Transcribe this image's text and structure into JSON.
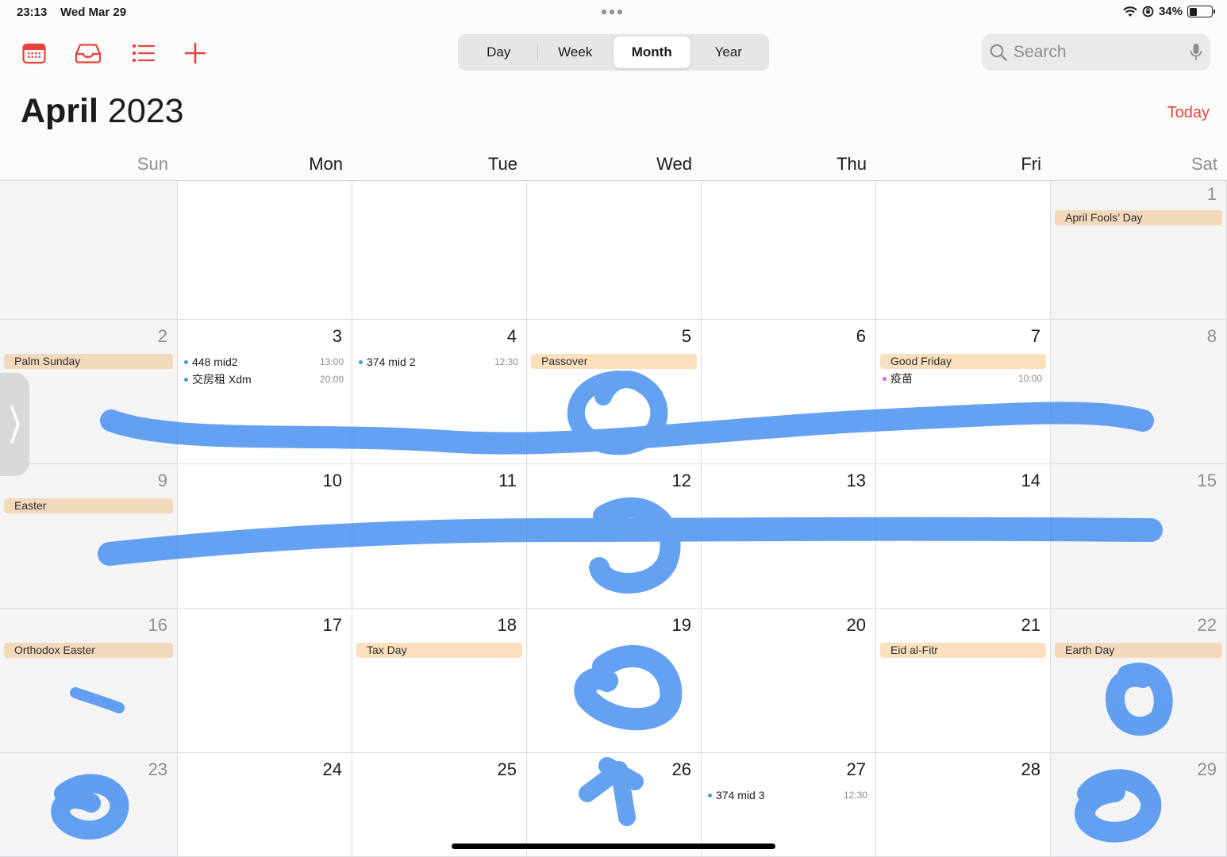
{
  "status_bar": {
    "time": "23:13",
    "date": "Wed Mar 29",
    "battery": "34%",
    "battery_level": 0.34
  },
  "toolbar": {
    "icons": [
      "calendar-icon",
      "inbox-icon",
      "list-icon",
      "add-icon"
    ],
    "views": [
      {
        "label": "Day",
        "active": false
      },
      {
        "label": "Week",
        "active": false
      },
      {
        "label": "Month",
        "active": true
      },
      {
        "label": "Year",
        "active": false
      }
    ],
    "search_placeholder": "Search"
  },
  "header": {
    "month": "April",
    "year": "2023",
    "today_label": "Today"
  },
  "weekdays": [
    "Sun",
    "Mon",
    "Tue",
    "Wed",
    "Thu",
    "Fri",
    "Sat"
  ],
  "weeks": [
    [
      {
        "day": ""
      },
      {
        "day": ""
      },
      {
        "day": ""
      },
      {
        "day": ""
      },
      {
        "day": ""
      },
      {
        "day": ""
      },
      {
        "day": "1",
        "allday": "April Fools’ Day"
      }
    ],
    [
      {
        "day": "2",
        "allday": "Palm Sunday"
      },
      {
        "day": "3",
        "events": [
          {
            "title": "448 mid2",
            "time": "13:00",
            "color": "#3b9eda"
          },
          {
            "title": "交房租 Xdm",
            "time": "20:00",
            "color": "#3b9eda"
          }
        ]
      },
      {
        "day": "4",
        "events": [
          {
            "title": "374 mid 2",
            "time": "12:30",
            "color": "#3b9eda"
          }
        ]
      },
      {
        "day": "5",
        "allday": "Passover"
      },
      {
        "day": "6"
      },
      {
        "day": "7",
        "allday": "Good Friday",
        "events": [
          {
            "title": "疫苗",
            "time": "10:00",
            "color": "#c86dd7"
          }
        ]
      },
      {
        "day": "8"
      }
    ],
    [
      {
        "day": "9",
        "allday": "Easter"
      },
      {
        "day": "10"
      },
      {
        "day": "11"
      },
      {
        "day": "12"
      },
      {
        "day": "13"
      },
      {
        "day": "14"
      },
      {
        "day": "15"
      }
    ],
    [
      {
        "day": "16",
        "allday": "Orthodox Easter"
      },
      {
        "day": "17"
      },
      {
        "day": "18",
        "allday": "Tax Day"
      },
      {
        "day": "19"
      },
      {
        "day": "20"
      },
      {
        "day": "21",
        "allday": "Eid al-Fitr"
      },
      {
        "day": "22",
        "allday": "Earth Day"
      }
    ],
    [
      {
        "day": "23"
      },
      {
        "day": "24"
      },
      {
        "day": "25"
      },
      {
        "day": "26"
      },
      {
        "day": "27",
        "events": [
          {
            "title": "374 mid 3",
            "time": "12:30",
            "color": "#3b9eda"
          }
        ]
      },
      {
        "day": "28"
      },
      {
        "day": "29"
      }
    ]
  ],
  "colors": {
    "accent": "#e5453a",
    "holiday_bg": "#fae0bc",
    "ink": "#3a87ee"
  }
}
